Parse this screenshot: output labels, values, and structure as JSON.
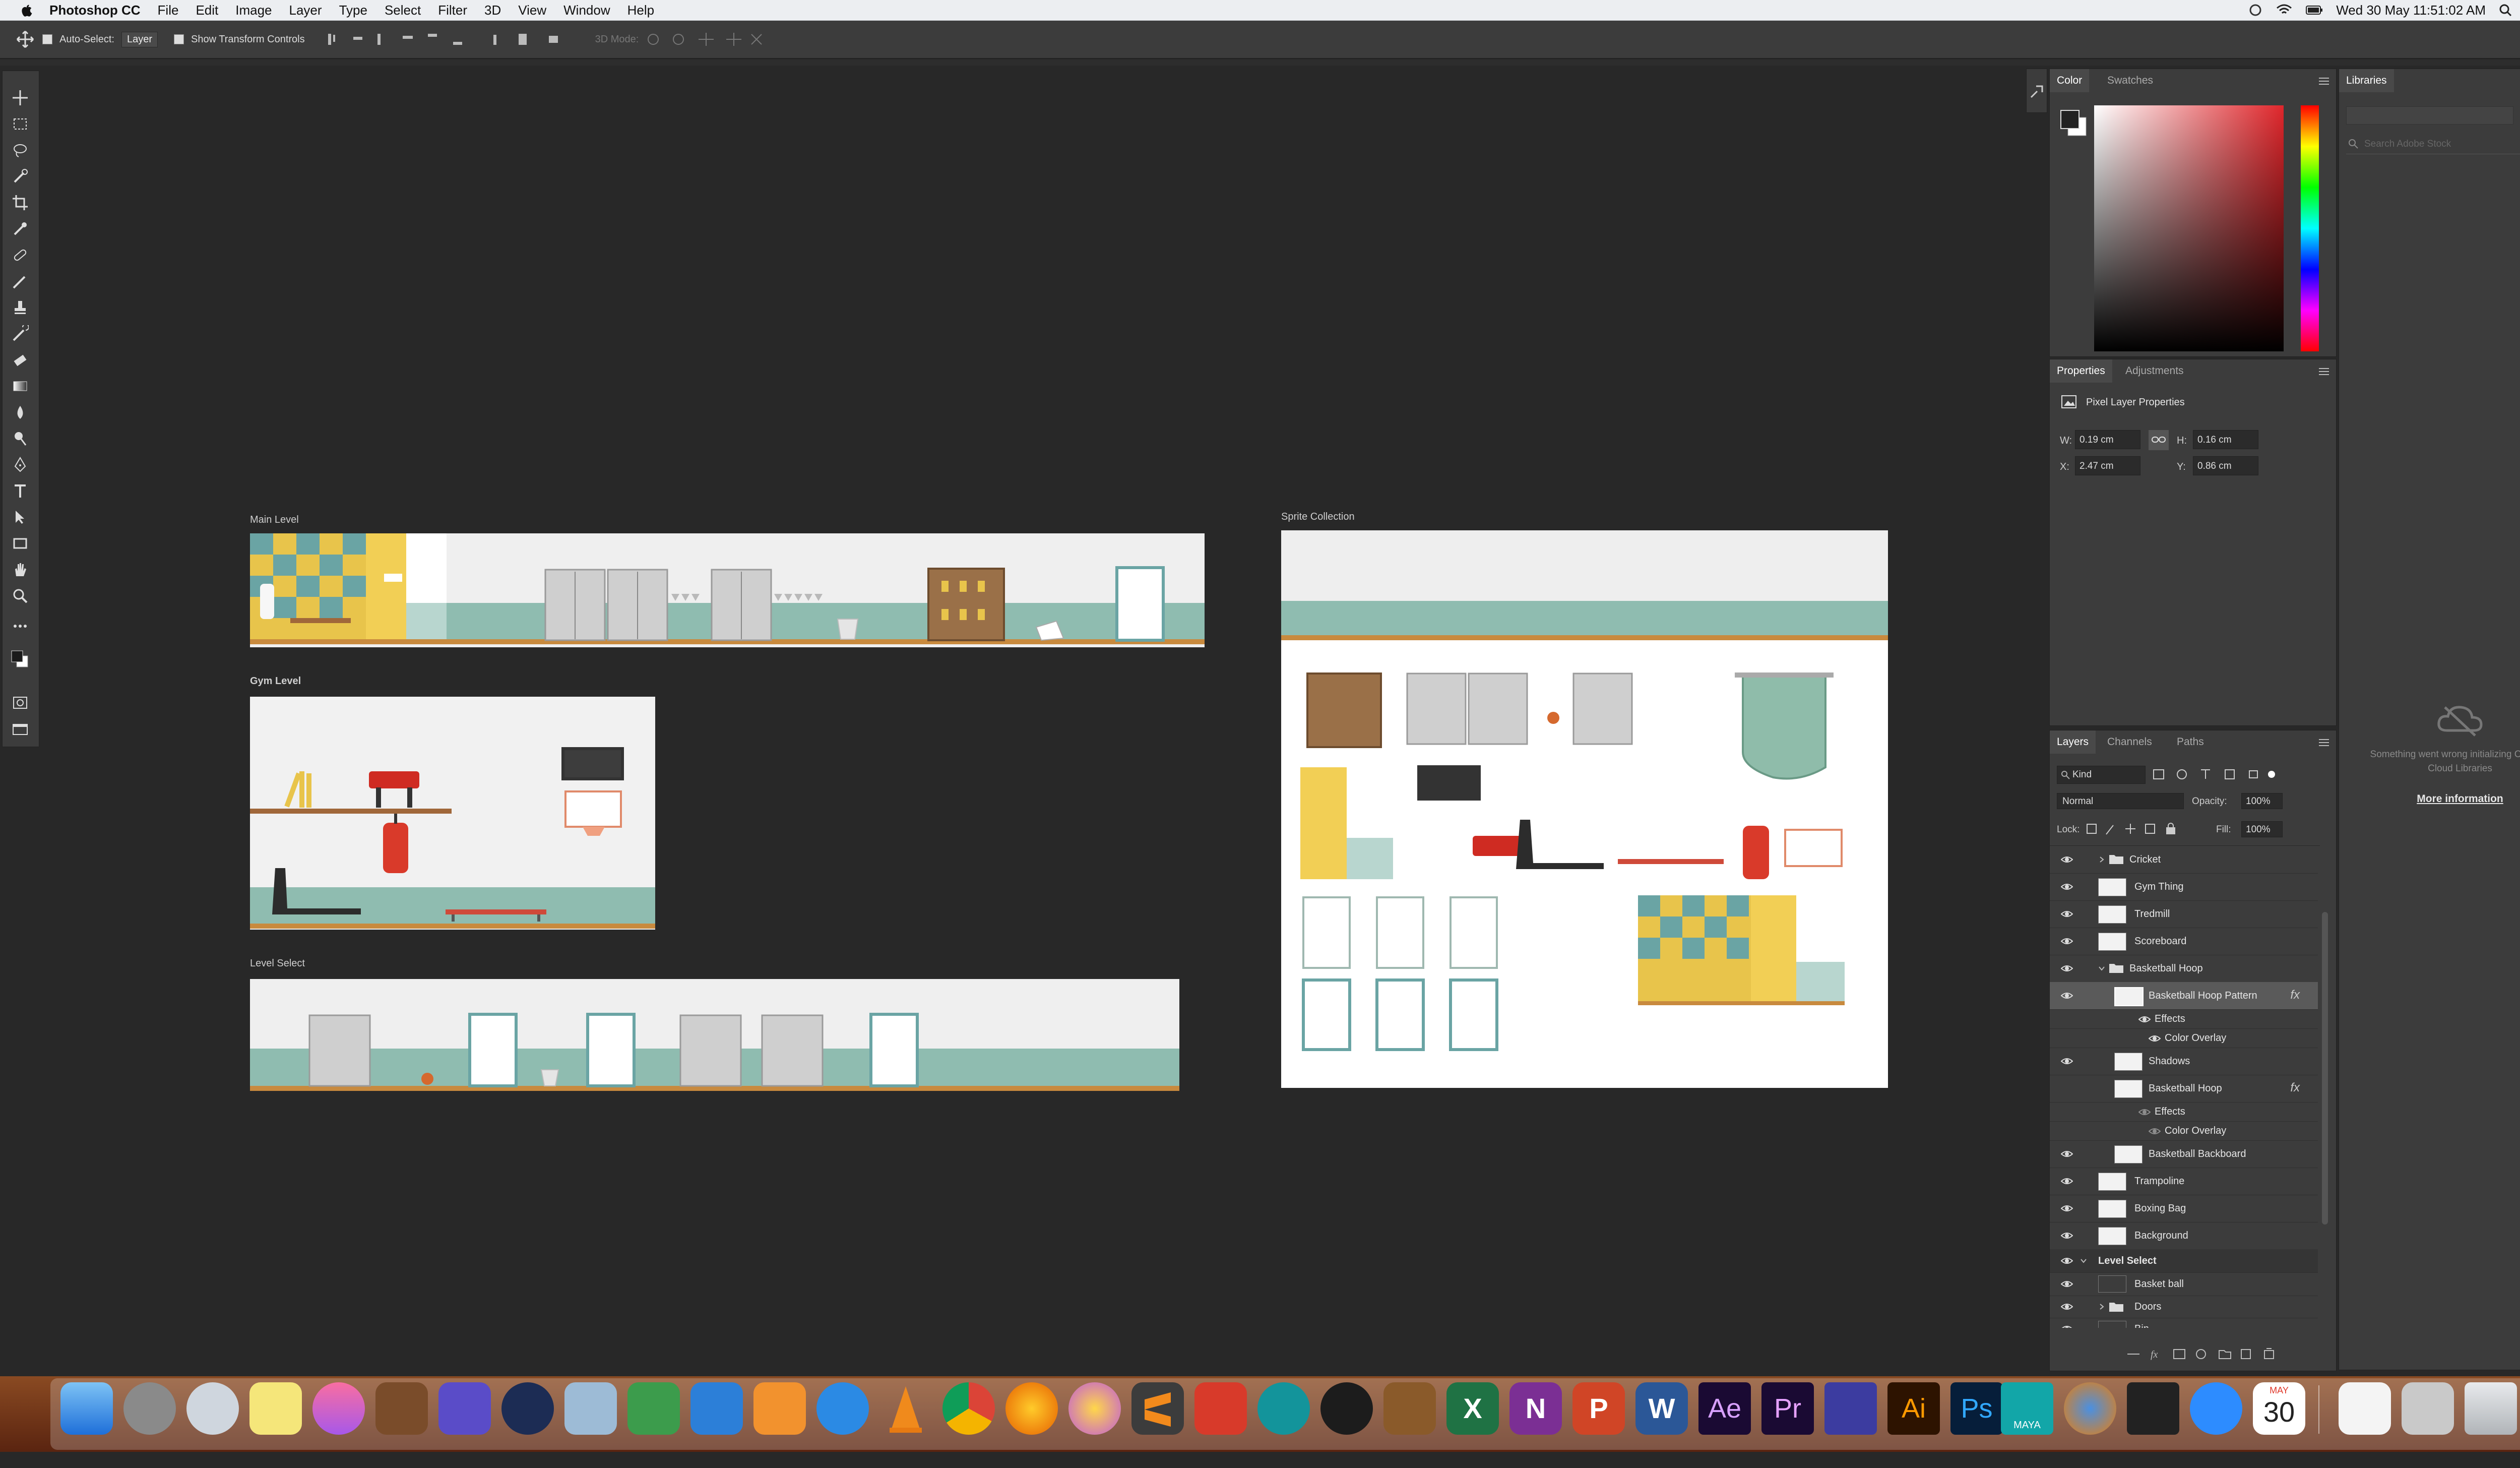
{
  "menubar": {
    "app_name": "Photoshop CC",
    "items": [
      "File",
      "Edit",
      "Image",
      "Layer",
      "Type",
      "Select",
      "Filter",
      "3D",
      "View",
      "Window",
      "Help"
    ],
    "clock": "Wed 30 May  11:51:02 AM"
  },
  "options_bar": {
    "auto_select_label": "Auto-Select:",
    "auto_select_value": "Layer",
    "show_transform_label": "Show Transform Controls",
    "mode_3d_label": "3D Mode:"
  },
  "canvas": {
    "artboards": [
      {
        "label": "Main Level"
      },
      {
        "label": "Gym Level"
      },
      {
        "label": "Level Select"
      },
      {
        "label": "Sprite Collection"
      }
    ]
  },
  "color_panel": {
    "tabs": [
      "Color",
      "Swatches"
    ],
    "picker_hue": "#e0262b"
  },
  "libraries_panel": {
    "tab": "Libraries",
    "search_placeholder": "Search Adobe Stock",
    "error_text": "Something went wrong initializing Creative Cloud Libraries",
    "more_info": "More information"
  },
  "properties_panel": {
    "tabs": [
      "Properties",
      "Adjustments"
    ],
    "title": "Pixel Layer Properties",
    "w_label": "W:",
    "w_value": "0.19 cm",
    "h_label": "H:",
    "h_value": "0.16 cm",
    "x_label": "X:",
    "x_value": "2.47 cm",
    "y_label": "Y:",
    "y_value": "0.86 cm"
  },
  "layers_panel": {
    "tabs": [
      "Layers",
      "Channels",
      "Paths"
    ],
    "filter_kind": "Kind",
    "blend_mode": "Normal",
    "opacity_label": "Opacity:",
    "opacity_value": "100%",
    "lock_label": "Lock:",
    "fill_label": "Fill:",
    "fill_value": "100%",
    "layers": [
      {
        "name": "Cricket",
        "type": "group"
      },
      {
        "name": "Gym Thing",
        "type": "layer"
      },
      {
        "name": "Tredmill",
        "type": "layer"
      },
      {
        "name": "Scoreboard",
        "type": "layer"
      },
      {
        "name": "Basketball Hoop",
        "type": "group-open"
      },
      {
        "name": "Basketball Hoop Pattern",
        "type": "layer-fx",
        "selected": true
      },
      {
        "name": "Effects",
        "type": "effects"
      },
      {
        "name": "Color Overlay",
        "type": "effect"
      },
      {
        "name": "Shadows",
        "type": "layer"
      },
      {
        "name": "Basketball Hoop",
        "type": "layer-fx",
        "hidden": true
      },
      {
        "name": "Effects",
        "type": "effects"
      },
      {
        "name": "Color Overlay",
        "type": "effect"
      },
      {
        "name": "Basketball Backboard",
        "type": "layer"
      },
      {
        "name": "Trampoline",
        "type": "layer"
      },
      {
        "name": "Boxing Bag",
        "type": "layer"
      },
      {
        "name": "Background",
        "type": "layer"
      },
      {
        "name": "Level Select",
        "type": "artboard"
      },
      {
        "name": "Basket ball",
        "type": "layer"
      },
      {
        "name": "Doors",
        "type": "group"
      },
      {
        "name": "Bin",
        "type": "layer"
      }
    ],
    "fx_label": "fx"
  },
  "dock": {
    "apps": [
      "Finder",
      "System Preferences",
      "Launchpad",
      "Notes",
      "iTunes",
      "GarageBand",
      "iMovie",
      "QuickTime",
      "Preview",
      "Numbers",
      "Keynote",
      "Pages",
      "Safari",
      "VLC",
      "Chrome",
      "Firefox",
      "Flower",
      "Sublime",
      "Fontlab",
      "Arduino",
      "Blender",
      "Cinema",
      "Excel",
      "OneNote",
      "PowerPoint",
      "Word",
      "After Effects",
      "Premiere",
      "Media",
      "Illustrator",
      "Photoshop",
      "Maya",
      "Blender3D",
      "Unity",
      "Zoom",
      "Calendar",
      "Notes2",
      "Downloads",
      "Trash"
    ],
    "app_glyphs": {
      "excel": "X",
      "onenote": "N",
      "powerpoint": "P",
      "word": "W",
      "ae": "Ae",
      "pr": "Pr",
      "ai": "Ai",
      "ps": "Ps",
      "calendar_day": "30",
      "calendar_month": "MAY",
      "maya": "MAYA"
    }
  }
}
